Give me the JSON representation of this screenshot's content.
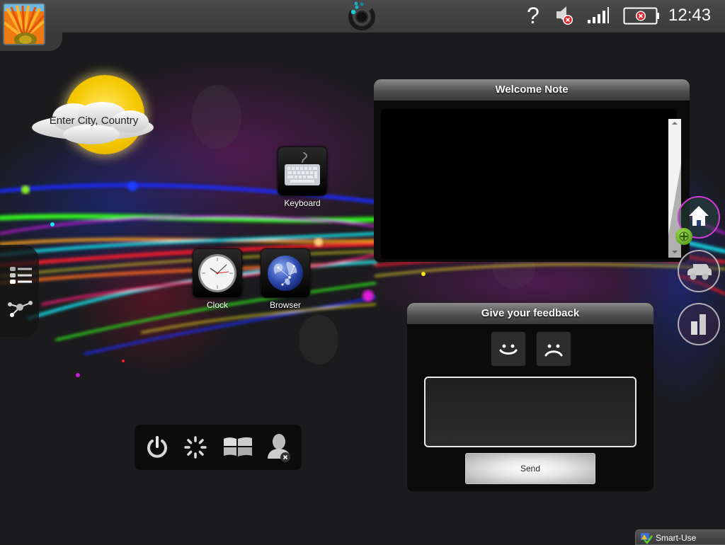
{
  "topbar": {
    "avatar_icon": "flower-photo-icon",
    "logo_icon": "loading-ring-logo-icon",
    "status_icons": [
      "help-icon",
      "speaker-muted-icon",
      "signal-strength-icon",
      "battery-error-icon"
    ],
    "help_glyph": "?",
    "time": "12:43"
  },
  "weather": {
    "placeholder": "Enter City, Country"
  },
  "left_dock": {
    "items": [
      {
        "icon": "list-icon"
      },
      {
        "icon": "network-icon"
      }
    ]
  },
  "apps": [
    {
      "label": "Keyboard",
      "icon": "keyboard-icon"
    },
    {
      "label": "Clock",
      "icon": "clock-icon"
    },
    {
      "label": "Browser",
      "icon": "globe-icon"
    }
  ],
  "welcome_note": {
    "title": "Welcome Note",
    "content": ""
  },
  "right_dock": {
    "items": [
      {
        "icon": "home-icon",
        "accent": "#d23bd6"
      },
      {
        "icon": "car-icon"
      },
      {
        "icon": "bar-chart-icon"
      }
    ],
    "add_icon": "add-icon"
  },
  "feedback": {
    "title": "Give your feedback",
    "happy_glyph": "☺",
    "sad_glyph": "☹",
    "text_value": "",
    "send_label": "Send"
  },
  "bottom_dock": {
    "items": [
      {
        "icon": "power-icon"
      },
      {
        "icon": "loading-spinner-icon"
      },
      {
        "icon": "windows-logo-icon"
      },
      {
        "icon": "user-remove-icon"
      }
    ]
  },
  "taskbar": {
    "label": "Smart-Use"
  },
  "colors": {
    "accent_cyan": "#1ec8d8",
    "error_red": "#e0232a",
    "add_green": "#6ab82c"
  }
}
